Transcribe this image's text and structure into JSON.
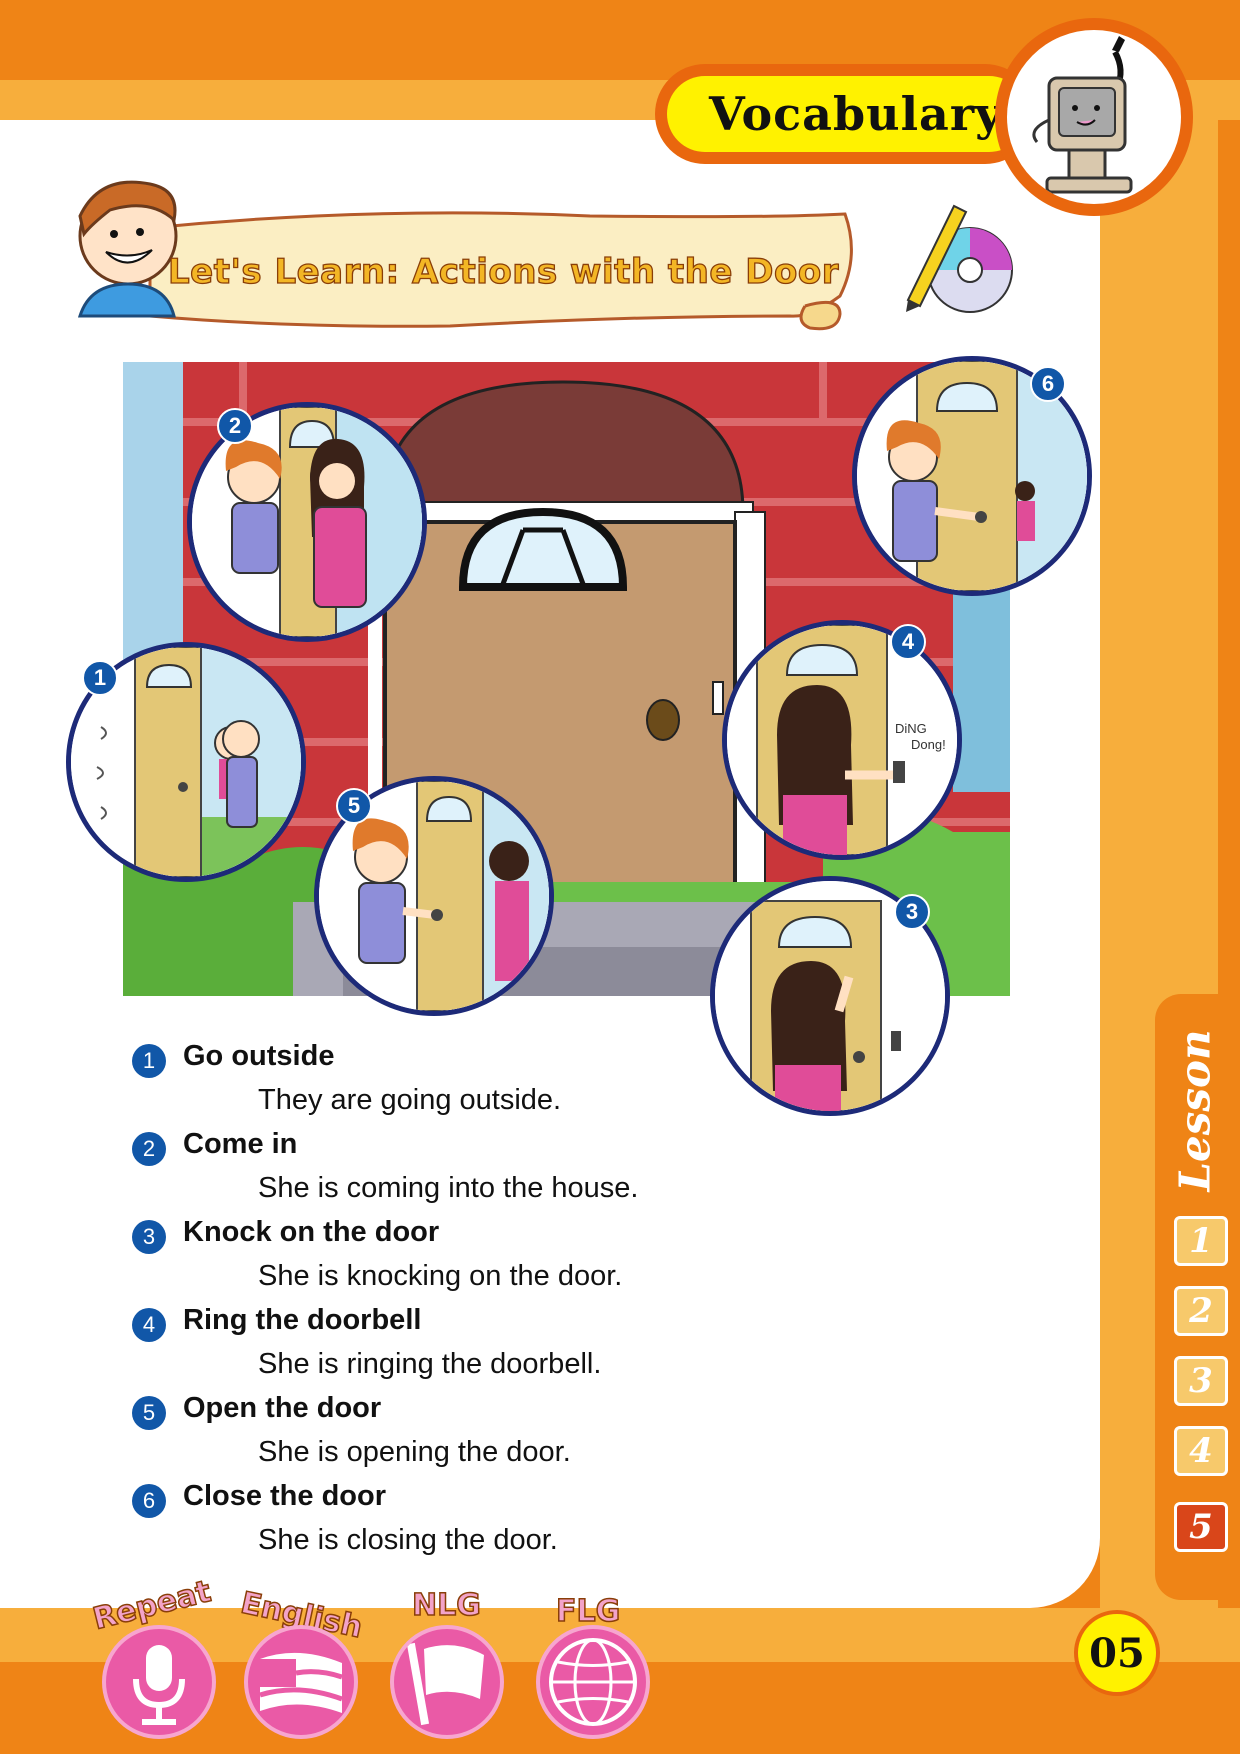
{
  "header": {
    "section_title": "Vocabulary"
  },
  "banner": {
    "title": "Let's Learn: Actions with the Door"
  },
  "vocabulary": [
    {
      "num": "1",
      "term": "Go outside",
      "sentence": "They are going outside."
    },
    {
      "num": "2",
      "term": "Come in",
      "sentence": "She is coming into the house."
    },
    {
      "num": "3",
      "term": "Knock on the door",
      "sentence": "She is knocking on the door."
    },
    {
      "num": "4",
      "term": "Ring the doorbell",
      "sentence": "She is ringing the doorbell."
    },
    {
      "num": "5",
      "term": "Open the door",
      "sentence": "She is opening the door."
    },
    {
      "num": "6",
      "term": "Close the door",
      "sentence": "She is closing the door."
    }
  ],
  "scene": {
    "badges": [
      "1",
      "2",
      "3",
      "4",
      "5",
      "6"
    ],
    "sound_text_1": "DiNG",
    "sound_text_2": "Dong!"
  },
  "lesson": {
    "label": "Lesson",
    "numbers": [
      "1",
      "2",
      "3",
      "4",
      "5"
    ],
    "active": "5"
  },
  "footer": {
    "page_number": "05",
    "buttons": [
      {
        "label": "Repeat",
        "icon": "microphone-icon"
      },
      {
        "label": "English",
        "icon": "us-flag-icon"
      },
      {
        "label": "NLG",
        "icon": "flag-icon"
      },
      {
        "label": "FLG",
        "icon": "globe-icon"
      }
    ]
  },
  "colors": {
    "orange": "#ef8416",
    "light_orange": "#f7ae3c",
    "yellow": "#fff200",
    "navy": "#1d2a78",
    "badge_blue": "#1157a8",
    "pink": "#ea5aa6"
  }
}
